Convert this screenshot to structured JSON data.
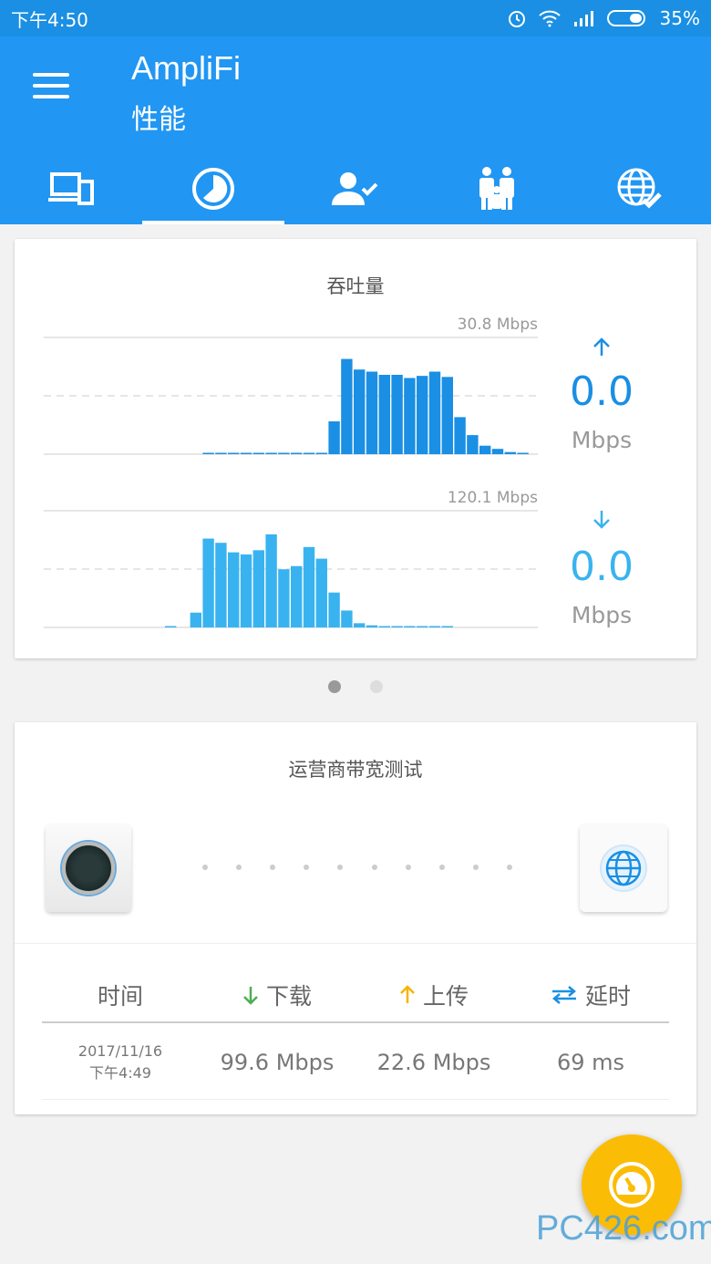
{
  "status_bar": {
    "time": "下午4:50",
    "battery": "35%"
  },
  "app": {
    "title": "AmpliFi",
    "subtitle": "性能"
  },
  "tabs": [
    {
      "icon": "devices-icon"
    },
    {
      "icon": "performance-icon",
      "active": true
    },
    {
      "icon": "user-check-icon"
    },
    {
      "icon": "family-icon"
    },
    {
      "icon": "internet-check-icon"
    }
  ],
  "throughput": {
    "title": "吞吐量",
    "upload": {
      "scale_label": "30.8 Mbps",
      "rate": "0.0",
      "unit": "Mbps",
      "color": "#1a8fe3"
    },
    "download": {
      "scale_label": "120.1 Mbps",
      "rate": "0.0",
      "unit": "Mbps",
      "color": "#39b3f0"
    }
  },
  "chart_data": [
    {
      "type": "bar",
      "series": [
        {
          "values": [
            0,
            0,
            0,
            0,
            0,
            0,
            0,
            0,
            0,
            0,
            0,
            0,
            0,
            0,
            0,
            0,
            0,
            0,
            0,
            0,
            0,
            0,
            0,
            0,
            0,
            0,
            0,
            0,
            0,
            0,
            0,
            0,
            0,
            0,
            0,
            0,
            0,
            0,
            0,
            0,
            0,
            0,
            0,
            0,
            0,
            0,
            0,
            0,
            0,
            0,
            0,
            0,
            0,
            0,
            0,
            0,
            0,
            0,
            0,
            0
          ]
        }
      ],
      "upload_values_percent": [
        0,
        0,
        0,
        0,
        0,
        0,
        0,
        0,
        0.4,
        0.4,
        0.4,
        0.4,
        0.4,
        0.4,
        0.4,
        0.4,
        0.4,
        0.4,
        31,
        90,
        80,
        78,
        75,
        75,
        72,
        74,
        78,
        73,
        35,
        18,
        8,
        5,
        2,
        1,
        0.5
      ]
    },
    {
      "type": "bar",
      "download_values_percent": [
        0,
        0,
        0,
        0,
        0,
        1,
        0,
        14,
        84,
        80,
        71,
        69,
        73,
        88,
        55,
        58,
        76,
        65,
        33,
        16,
        4,
        2,
        1,
        1,
        1,
        1,
        1,
        1
      ]
    }
  ],
  "pager": {
    "pages": 2,
    "current": 1
  },
  "isp_test": {
    "title": "运营商带宽测试",
    "columns": {
      "time": "时间",
      "download": "下载",
      "upload": "上传",
      "latency": "延时"
    },
    "row": {
      "date": "2017/11/16",
      "time": "下午4:49",
      "download": "99.6 Mbps",
      "upload": "22.6 Mbps",
      "latency": "69 ms"
    },
    "colors": {
      "download": "#4caf50",
      "upload": "#f5b400",
      "latency": "#1a8fe3"
    }
  },
  "watermark": "PC426.com"
}
